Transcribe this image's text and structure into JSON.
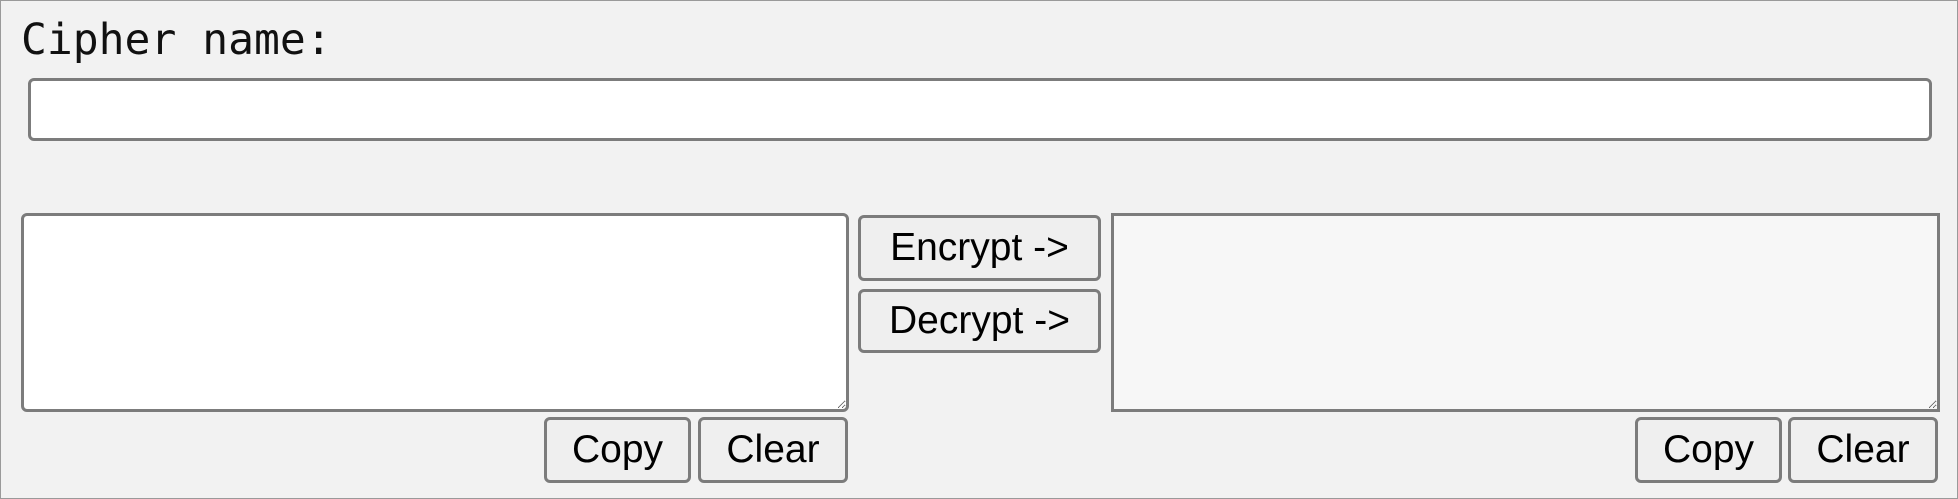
{
  "cipher": {
    "label": "Cipher name:",
    "value": ""
  },
  "input_pane": {
    "text": "",
    "copy_label": "Copy",
    "clear_label": "Clear"
  },
  "actions": {
    "encrypt_label": "Encrypt ->",
    "decrypt_label": "Decrypt ->"
  },
  "output_pane": {
    "text": "",
    "copy_label": "Copy",
    "clear_label": "Clear"
  },
  "colors": {
    "page_background": "#f2f2f2",
    "border": "#7c7c7c",
    "button_background": "#efefef",
    "output_background": "#f7f7f7"
  }
}
